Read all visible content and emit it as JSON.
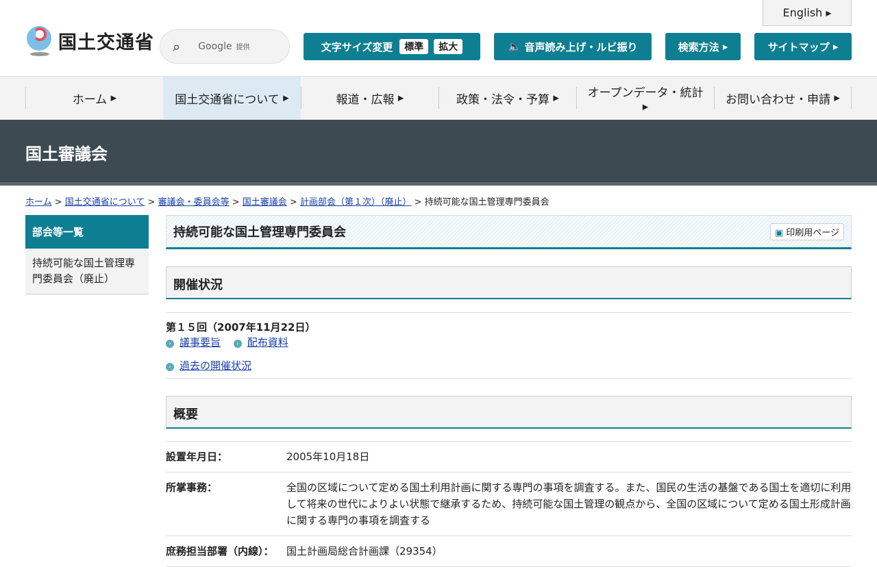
{
  "header": {
    "logo": "国土交通省",
    "search_label": "Google",
    "search_sub": "提供",
    "english": "English",
    "font_size": "文字サイズ変更",
    "font_std": "標準",
    "font_big": "拡大",
    "speech": "音声読み上げ・ルビ振り",
    "search_method": "検索方法",
    "sitemap": "サイトマップ"
  },
  "nav": [
    "ホーム",
    "国土交通省について",
    "報道・広報",
    "政策・法令・予算",
    "オープンデータ・統計",
    "お問い合わせ・申請"
  ],
  "banner": "国土審議会",
  "breadcrumb": [
    "ホーム",
    "国土交通省について",
    "審議会・委員会等",
    "国土審議会",
    "計画部会（第１次）（廃止）",
    "持続可能な国土管理専門委員会"
  ],
  "sidebar": {
    "heading": "部会等一覧",
    "item": "持続可能な国土管理専門委員会（廃止）"
  },
  "main": {
    "title": "持続可能な国土管理専門委員会",
    "print": "印刷用ページ",
    "sec1": "開催状況",
    "meeting": "第１５回（2007年11月22日）",
    "link1": "議事要旨",
    "link2": "配布資料",
    "past": "過去の開催状況",
    "sec2": "概要",
    "rows": [
      {
        "k": "設置年月日：",
        "v": "2005年10月18日"
      },
      {
        "k": "所掌事務：",
        "v": "全国の区域について定める国土利用計画に関する専門の事項を調査する。また、国民の生活の基盤である国土を適切に利用して将来の世代によりよい状態で継承するため、持続可能な国土管理の観点から、全国の区域について定める国土形成計画に関する専門の事項を調査する"
      },
      {
        "k": "庶務担当部署（内線）：",
        "v": "国土計画局総合計画課（29354）"
      }
    ]
  }
}
